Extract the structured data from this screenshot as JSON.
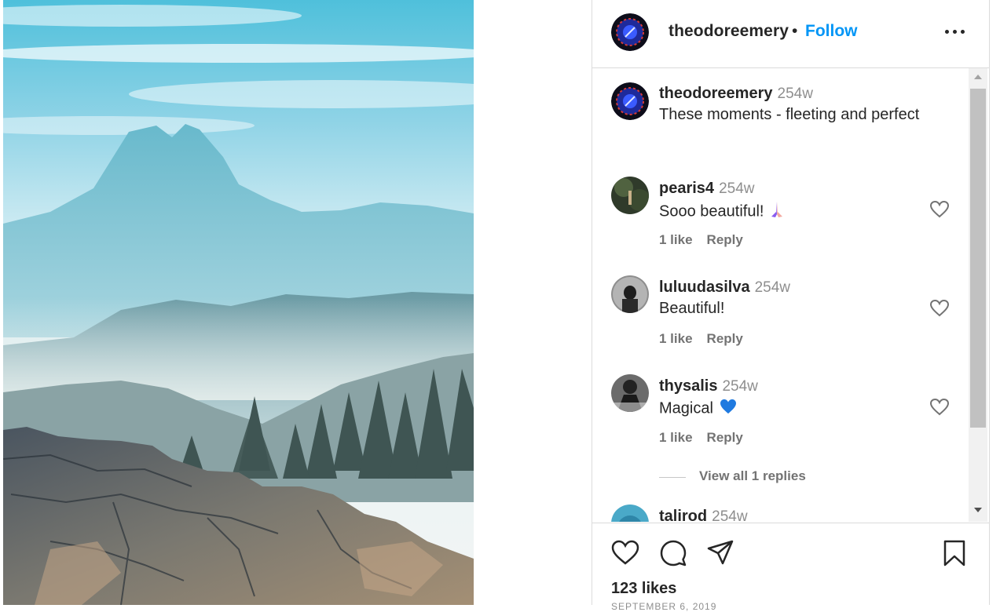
{
  "post": {
    "image_icon": "landscape-photo",
    "author": "theodoreemery",
    "separator": "•",
    "follow_label": "Follow",
    "more_icon": "more-horizontal-icon"
  },
  "caption": {
    "user": "theodoreemery",
    "time": "254w",
    "text": "These moments - fleeting and perfect"
  },
  "comments": [
    {
      "user": "pearis4",
      "time": "254w",
      "text": "Sooo beautiful!",
      "emoji": "folded-hands-icon",
      "likes": "1 like",
      "reply": "Reply"
    },
    {
      "user": "luluudasilva",
      "time": "254w",
      "text": "Beautiful!",
      "likes": "1 like",
      "reply": "Reply"
    },
    {
      "user": "thysalis",
      "time": "254w",
      "text": "Magical",
      "emoji": "blue-heart-icon",
      "likes": "1 like",
      "reply": "Reply"
    },
    {
      "user": "talirod",
      "time": "254w"
    }
  ],
  "view_replies_label": "View all 1 replies",
  "actions": {
    "like_icon": "heart-icon",
    "comment_icon": "comment-icon",
    "share_icon": "send-icon",
    "save_icon": "bookmark-icon"
  },
  "likes_text": "123 likes",
  "date_text": "SEPTEMBER 6, 2019",
  "colors": {
    "accent": "#0095f6",
    "text": "#262626",
    "muted": "#8e8e8e",
    "border": "#dbdbdb"
  }
}
